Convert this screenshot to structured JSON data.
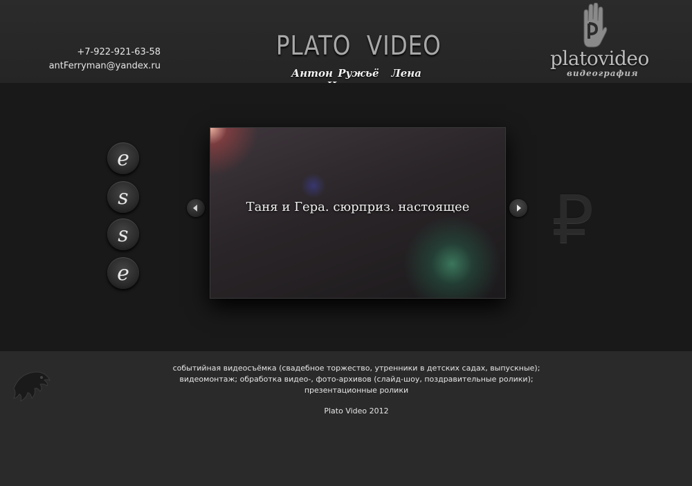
{
  "header": {
    "phone": "+7-922-921-63-58",
    "email": "antFerryman@yandex.ru",
    "title": "PLATO  VIDEO",
    "names": [
      "Антон Ружьё",
      "Лена Никонова"
    ],
    "logo": {
      "word": "platovideo",
      "subtitle": "видеография",
      "icon": "hand-logo-icon"
    }
  },
  "side_nav": {
    "buttons": [
      {
        "letter": "e"
      },
      {
        "letter": "s"
      },
      {
        "letter": "s"
      },
      {
        "letter": "e"
      }
    ]
  },
  "slider": {
    "title": "Таня и Гера. сюрприз. настоящее",
    "prev_icon": "arrow-left-icon",
    "next_icon": "arrow-right-icon"
  },
  "decor": {
    "ruble_symbol": "₽"
  },
  "footer": {
    "services": [
      "событийная видеосъёмка (свадебное торжество, утренники в детских садах, выпускные);",
      "видеомонтаж; обработка видео-, фото-архивов (слайд-шоу, поздравительные ролики);",
      "презентационные ролики"
    ],
    "copyright": "Plato Video 2012",
    "eagle_icon": "eagle-icon"
  }
}
